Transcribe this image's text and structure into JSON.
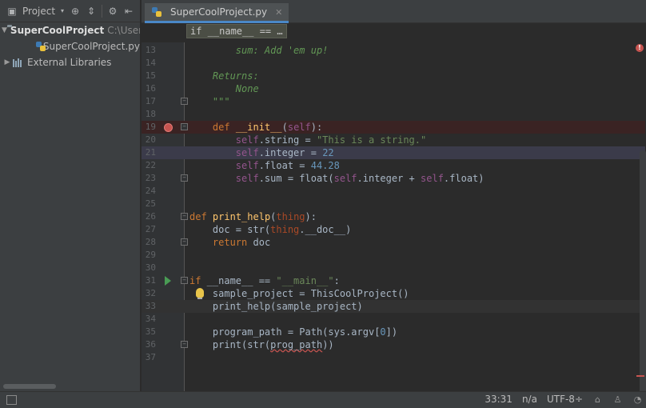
{
  "project_panel": {
    "toolbar_label": "Project",
    "root": {
      "name": "SuperCoolProject",
      "path": "C:\\Users"
    },
    "file": "SuperCoolProject.py",
    "libraries": "External Libraries"
  },
  "editor": {
    "tab_label": "SuperCoolProject.py",
    "breadcrumb": "if __name__ == …",
    "lines": [
      {
        "n": "13",
        "html": "        <span class='doc'>sum: Add 'em up!</span>"
      },
      {
        "n": "14",
        "html": ""
      },
      {
        "n": "15",
        "html": "    <span class='doc'>Returns:</span>"
      },
      {
        "n": "16",
        "html": "        <span class='doc'>None</span>"
      },
      {
        "n": "17",
        "html": "    <span class='doc'>\"\"\"</span>"
      },
      {
        "n": "18",
        "html": ""
      },
      {
        "n": "19",
        "html": "    <span class='kw'>def</span> <span class='fn'>__init__</span>(<span class='self'>self</span>):"
      },
      {
        "n": "20",
        "html": "        <span class='self'>self</span>.string = <span class='str'>\"This is a string.\"</span>"
      },
      {
        "n": "21",
        "html": "        <span class='self'>self</span>.integer = <span class='num'>22</span>"
      },
      {
        "n": "22",
        "html": "        <span class='self'>self</span>.float = <span class='num'>44.28</span>"
      },
      {
        "n": "23",
        "html": "        <span class='self'>self</span>.sum = float(<span class='self'>self</span>.integer + <span class='self'>self</span>.float)"
      },
      {
        "n": "24",
        "html": ""
      },
      {
        "n": "25",
        "html": ""
      },
      {
        "n": "26",
        "html": "<span class='kw'>def</span> <span class='fn'>print_help</span>(<span class='param'>thing</span>):"
      },
      {
        "n": "27",
        "html": "    doc = str(<span class='param'>thing</span>.__doc__)"
      },
      {
        "n": "28",
        "html": "    <span class='kw'>return</span> doc"
      },
      {
        "n": "29",
        "html": ""
      },
      {
        "n": "30",
        "html": ""
      },
      {
        "n": "31",
        "html": "<span class='kw'>if</span> __name__ == <span class='str'>\"__main__\"</span>:"
      },
      {
        "n": "32",
        "html": "    sample_project = ThisCoolProject()"
      },
      {
        "n": "33",
        "html": "    print_help(sample_project)"
      },
      {
        "n": "34",
        "html": ""
      },
      {
        "n": "35",
        "html": "    program_path = Path(sys.argv[<span class='num'>0</span>])"
      },
      {
        "n": "36",
        "html": "    print(str(<span class='squiggle'>prog_path</span>))"
      },
      {
        "n": "37",
        "html": ""
      }
    ]
  },
  "status_bar": {
    "position": "33:31",
    "line_sep": "n/a",
    "encoding": "UTF-8"
  },
  "colors": {
    "accent": "#4a88c7",
    "breakpoint": "#c75450",
    "run": "#499c54"
  }
}
